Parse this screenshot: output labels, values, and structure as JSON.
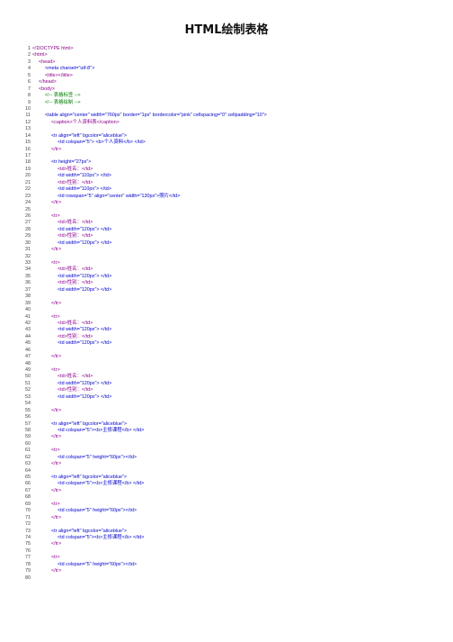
{
  "title": "HTML绘制表格",
  "colors": {
    "tag": "#8b008b",
    "attr": "#0000cc",
    "comment": "#008000",
    "text": "#222222"
  },
  "lines": [
    {
      "n": "1",
      "indent": 0,
      "kind": "tag",
      "text": "<!DOCTYPE html>"
    },
    {
      "n": "2",
      "indent": 0,
      "kind": "tag",
      "text": "<html>"
    },
    {
      "n": "3",
      "indent": 1,
      "kind": "tag",
      "text": "<head>"
    },
    {
      "n": "4",
      "indent": 2,
      "kind": "attr",
      "text": "<meta charset=\"utf-8\">"
    },
    {
      "n": "5",
      "indent": 2,
      "kind": "tag",
      "text": "<title></title>"
    },
    {
      "n": "6",
      "indent": 1,
      "kind": "tag",
      "text": "</head>"
    },
    {
      "n": "7",
      "indent": 1,
      "kind": "tag",
      "text": "<body>"
    },
    {
      "n": "8",
      "indent": 2,
      "kind": "comment",
      "text": "<!-- 表格标签 -->"
    },
    {
      "n": "9",
      "indent": 2,
      "kind": "comment",
      "text": "<!-- 表格绘制 -->"
    },
    {
      "n": "10",
      "indent": 0,
      "kind": "plain",
      "text": ""
    },
    {
      "n": "11",
      "indent": 2,
      "kind": "attr",
      "text": "<table align=\"center\" width=\"760px\" border=\"1px\" bordercolor=\"pink\" cellspacing=\"0\" cellpadding=\"10\">"
    },
    {
      "n": "12",
      "indent": 3,
      "kind": "tag",
      "text": "<caption>个人资料表</caption>"
    },
    {
      "n": "13",
      "indent": 0,
      "kind": "plain",
      "text": ""
    },
    {
      "n": "14",
      "indent": 3,
      "kind": "attr",
      "text": "<tr align=\"left\" bgcolor=\"aliceblue\">"
    },
    {
      "n": "15",
      "indent": 4,
      "kind": "attr",
      "text": "<td colspan=\"5\"> <b>个人资料</b> </td>"
    },
    {
      "n": "16",
      "indent": 3,
      "kind": "tag",
      "text": "</tr>"
    },
    {
      "n": "17",
      "indent": 0,
      "kind": "plain",
      "text": ""
    },
    {
      "n": "18",
      "indent": 3,
      "kind": "attr",
      "text": "<tr height=\"27px\">"
    },
    {
      "n": "19",
      "indent": 4,
      "kind": "tag",
      "text": "<td>姓名：</td>"
    },
    {
      "n": "20",
      "indent": 4,
      "kind": "attr",
      "text": "<td width=\"110px\"> </td>"
    },
    {
      "n": "21",
      "indent": 4,
      "kind": "tag",
      "text": "<td>性别：</td>"
    },
    {
      "n": "22",
      "indent": 4,
      "kind": "attr",
      "text": "<td width=\"110px\"> </td>"
    },
    {
      "n": "23",
      "indent": 4,
      "kind": "attr",
      "text": "<td rowspan=\"5\" align=\"center\" width=\"130px\">照片</td>"
    },
    {
      "n": "24",
      "indent": 3,
      "kind": "tag",
      "text": "</tr>"
    },
    {
      "n": "25",
      "indent": 0,
      "kind": "plain",
      "text": ""
    },
    {
      "n": "26",
      "indent": 3,
      "kind": "tag",
      "text": "<tr>"
    },
    {
      "n": "27",
      "indent": 4,
      "kind": "tag",
      "text": "<td>姓名：</td>"
    },
    {
      "n": "28",
      "indent": 4,
      "kind": "attr",
      "text": "<td width=\"120px\"> </td>"
    },
    {
      "n": "29",
      "indent": 4,
      "kind": "tag",
      "text": "<td>性别：</td>"
    },
    {
      "n": "30",
      "indent": 4,
      "kind": "attr",
      "text": "<td width=\"120px\"> </td>"
    },
    {
      "n": "31",
      "indent": 3,
      "kind": "tag",
      "text": "</tr>"
    },
    {
      "n": "32",
      "indent": 0,
      "kind": "plain",
      "text": ""
    },
    {
      "n": "33",
      "indent": 3,
      "kind": "tag",
      "text": "<tr>"
    },
    {
      "n": "34",
      "indent": 4,
      "kind": "tag",
      "text": "<td>姓名：</td>"
    },
    {
      "n": "35",
      "indent": 4,
      "kind": "attr",
      "text": "<td width=\"120px\"> </td>"
    },
    {
      "n": "36",
      "indent": 4,
      "kind": "tag",
      "text": "<td>性别：</td>"
    },
    {
      "n": "37",
      "indent": 4,
      "kind": "attr",
      "text": "<td width=\"120px\"> </td>"
    },
    {
      "n": "38",
      "indent": 0,
      "kind": "plain",
      "text": ""
    },
    {
      "n": "39",
      "indent": 3,
      "kind": "tag",
      "text": "</tr>"
    },
    {
      "n": "40",
      "indent": 0,
      "kind": "plain",
      "text": ""
    },
    {
      "n": "41",
      "indent": 3,
      "kind": "tag",
      "text": "<tr>"
    },
    {
      "n": "42",
      "indent": 4,
      "kind": "tag",
      "text": "<td>姓名：</td>"
    },
    {
      "n": "43",
      "indent": 4,
      "kind": "attr",
      "text": "<td width=\"120px\"> </td>"
    },
    {
      "n": "44",
      "indent": 4,
      "kind": "tag",
      "text": "<td>性别：</td>"
    },
    {
      "n": "45",
      "indent": 4,
      "kind": "attr",
      "text": "<td width=\"120px\"> </td>"
    },
    {
      "n": "46",
      "indent": 0,
      "kind": "plain",
      "text": ""
    },
    {
      "n": "47",
      "indent": 3,
      "kind": "tag",
      "text": "</tr>"
    },
    {
      "n": "48",
      "indent": 0,
      "kind": "plain",
      "text": ""
    },
    {
      "n": "49",
      "indent": 3,
      "kind": "tag",
      "text": "<tr>"
    },
    {
      "n": "50",
      "indent": 4,
      "kind": "tag",
      "text": "<td>姓名：</td>"
    },
    {
      "n": "51",
      "indent": 4,
      "kind": "attr",
      "text": "<td width=\"120px\"> </td>"
    },
    {
      "n": "52",
      "indent": 4,
      "kind": "tag",
      "text": "<td>性别：</td>"
    },
    {
      "n": "53",
      "indent": 4,
      "kind": "attr",
      "text": "<td width=\"120px\"> </td>"
    },
    {
      "n": "54",
      "indent": 0,
      "kind": "plain",
      "text": ""
    },
    {
      "n": "55",
      "indent": 3,
      "kind": "tag",
      "text": "</tr>"
    },
    {
      "n": "56",
      "indent": 0,
      "kind": "plain",
      "text": ""
    },
    {
      "n": "57",
      "indent": 3,
      "kind": "attr",
      "text": "<tr align=\"left\" bgcolor=\"aliceblue\">"
    },
    {
      "n": "58",
      "indent": 4,
      "kind": "attr",
      "text": "<td colspan=\"5\"><b>主修课程</b> </td>"
    },
    {
      "n": "59",
      "indent": 3,
      "kind": "tag",
      "text": "</tr>"
    },
    {
      "n": "60",
      "indent": 0,
      "kind": "plain",
      "text": ""
    },
    {
      "n": "61",
      "indent": 3,
      "kind": "tag",
      "text": "<tr>"
    },
    {
      "n": "62",
      "indent": 4,
      "kind": "attr",
      "text": "<td colspan=\"5\" height=\"60px\"></td>"
    },
    {
      "n": "63",
      "indent": 3,
      "kind": "tag",
      "text": "</tr>"
    },
    {
      "n": "64",
      "indent": 0,
      "kind": "plain",
      "text": ""
    },
    {
      "n": "65",
      "indent": 3,
      "kind": "attr",
      "text": "<tr align=\"left\" bgcolor=\"aliceblue\">"
    },
    {
      "n": "66",
      "indent": 4,
      "kind": "attr",
      "text": "<td colspan=\"5\"><b>主修课程</b> </td>"
    },
    {
      "n": "67",
      "indent": 3,
      "kind": "tag",
      "text": "</tr>"
    },
    {
      "n": "68",
      "indent": 0,
      "kind": "plain",
      "text": ""
    },
    {
      "n": "69",
      "indent": 3,
      "kind": "tag",
      "text": "<tr>"
    },
    {
      "n": "70",
      "indent": 4,
      "kind": "attr",
      "text": "<td colspan=\"5\" height=\"60px\"></td>"
    },
    {
      "n": "71",
      "indent": 3,
      "kind": "tag",
      "text": "</tr>"
    },
    {
      "n": "72",
      "indent": 0,
      "kind": "plain",
      "text": ""
    },
    {
      "n": "73",
      "indent": 3,
      "kind": "attr",
      "text": "<tr align=\"left\" bgcolor=\"aliceblue\">"
    },
    {
      "n": "74",
      "indent": 4,
      "kind": "attr",
      "text": "<td colspan=\"5\"><b>主修课程</b> </td>"
    },
    {
      "n": "75",
      "indent": 3,
      "kind": "tag",
      "text": "</tr>"
    },
    {
      "n": "76",
      "indent": 0,
      "kind": "plain",
      "text": ""
    },
    {
      "n": "77",
      "indent": 3,
      "kind": "tag",
      "text": "<tr>"
    },
    {
      "n": "78",
      "indent": 4,
      "kind": "attr",
      "text": "<td colspan=\"5\" height=\"60px\"></td>"
    },
    {
      "n": "79",
      "indent": 3,
      "kind": "tag",
      "text": "</tr>"
    },
    {
      "n": "80",
      "indent": 0,
      "kind": "plain",
      "text": ""
    }
  ]
}
